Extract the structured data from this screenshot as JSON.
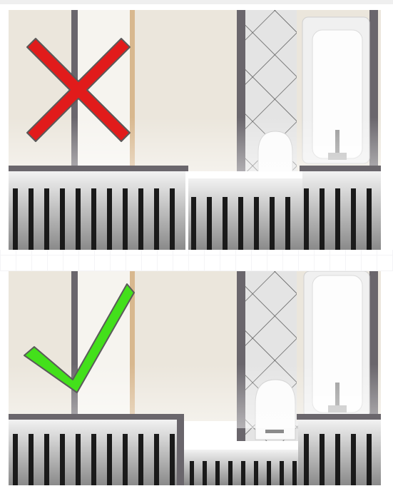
{
  "panels": [
    {
      "id": "top",
      "verdict": "incorrect",
      "symbol": "cross-icon",
      "color": "#e11b1b"
    },
    {
      "id": "bottom",
      "verdict": "correct",
      "symbol": "check-icon",
      "color": "#43e01b"
    }
  ],
  "colors": {
    "wall": "#ebe6dc",
    "wall_dark": "#e0dbd1",
    "post": "#666168",
    "tile": "#dcdcdc",
    "tile_line": "#4f4f4f",
    "cross": "#e11b1b",
    "check": "#43e01b",
    "outline": "#5a5a5a"
  }
}
